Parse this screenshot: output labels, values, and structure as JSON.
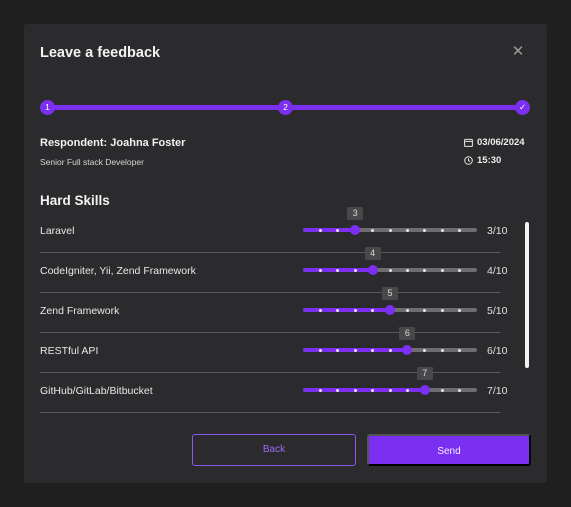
{
  "dialog": {
    "title": "Leave a feedback"
  },
  "stepper": {
    "steps": [
      "1",
      "2",
      "✓"
    ]
  },
  "respondent": {
    "name": "Respondent: Joahna Foster",
    "role": "Senior Full stack Developer",
    "date": "03/06/2024",
    "time": "15:30"
  },
  "section": {
    "title": "Hard Skills"
  },
  "skills": [
    {
      "label": "Laravel",
      "value": 3,
      "max": 10,
      "tooltip": "3",
      "score": "3/10"
    },
    {
      "label": "CodeIgniter, Yii, Zend Framework",
      "value": 4,
      "max": 10,
      "tooltip": "4",
      "score": "4/10"
    },
    {
      "label": "Zend Framework",
      "value": 5,
      "max": 10,
      "tooltip": "5",
      "score": "5/10"
    },
    {
      "label": "RESTful API",
      "value": 6,
      "max": 10,
      "tooltip": "6",
      "score": "6/10"
    },
    {
      "label": "GitHub/GitLab/Bitbucket",
      "value": 7,
      "max": 10,
      "tooltip": "7",
      "score": "7/10"
    }
  ],
  "actions": {
    "back_label": "Back",
    "send_label": "Send"
  },
  "icons": {
    "close": "close-icon",
    "calendar": "calendar-icon",
    "clock": "clock-icon",
    "check": "check-icon"
  },
  "colors": {
    "accent": "#7b2ff0",
    "track": "#6e6e70",
    "background": "#2b2b2d"
  }
}
